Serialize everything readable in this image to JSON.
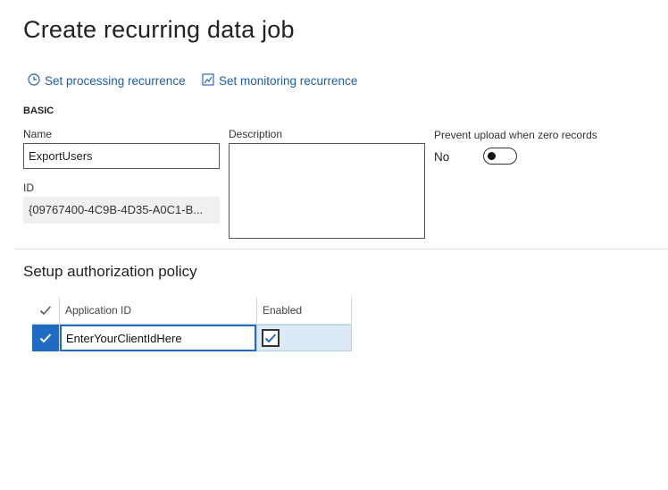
{
  "page": {
    "title": "Create recurring data job"
  },
  "actions": {
    "processing_label": "Set processing recurrence",
    "processing_icon": "clock-icon",
    "monitoring_label": "Set monitoring recurrence",
    "monitoring_icon": "chart-icon"
  },
  "basic": {
    "section_label": "BASIC",
    "name_label": "Name",
    "name_value": "ExportUsers",
    "id_label": "ID",
    "id_value": "{09767400-4C9B-4D35-A0C1-B...",
    "description_label": "Description",
    "description_value": "",
    "prevent_upload_label": "Prevent upload when zero records",
    "prevent_upload_value": "No",
    "prevent_upload_enabled": false
  },
  "authorization": {
    "title": "Setup authorization policy",
    "columns": {
      "select": "",
      "application_id": "Application ID",
      "enabled": "Enabled"
    },
    "rows": [
      {
        "application_id": "EnterYourClientIdHere",
        "enabled": true,
        "selected": true
      }
    ]
  },
  "colors": {
    "accent": "#1f6dc2",
    "link": "#1f5ea8",
    "row_highlight": "#dceaf8"
  }
}
